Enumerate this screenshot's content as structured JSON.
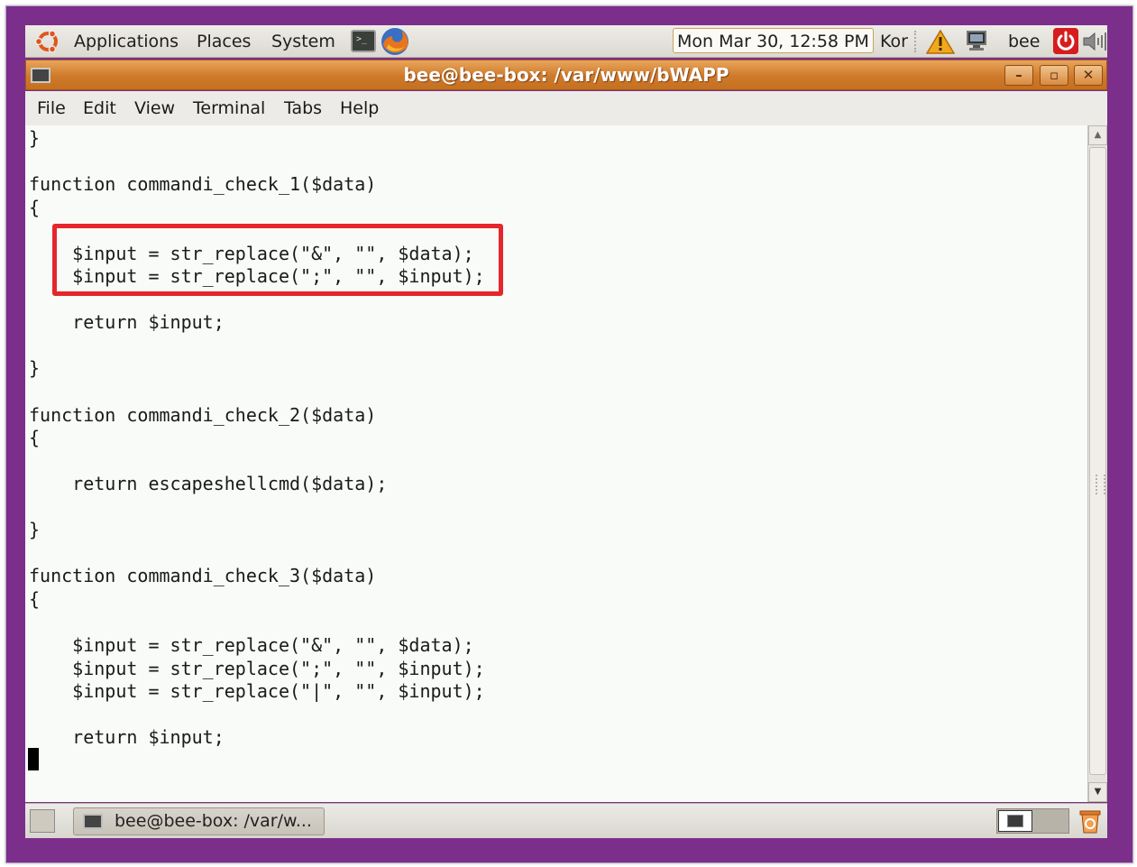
{
  "top_panel": {
    "menus": [
      "Applications",
      "Places",
      "System"
    ],
    "clock": "Mon Mar 30, 12:58 PM",
    "keyboard_layout": "Kor",
    "user": "bee",
    "icons": [
      "ubuntu-logo-icon",
      "terminal-launcher-icon",
      "firefox-icon",
      "warning-icon",
      "network-icon",
      "power-icon",
      "volume-icon"
    ]
  },
  "window": {
    "title": "bee@bee-box: /var/www/bWAPP",
    "buttons": {
      "minimize": "–",
      "maximize": "▫",
      "close": "✕"
    }
  },
  "menubar": [
    "File",
    "Edit",
    "View",
    "Terminal",
    "Tabs",
    "Help"
  ],
  "terminal": {
    "lines": [
      "}",
      "",
      "function commandi_check_1($data)",
      "{",
      "",
      "    $input = str_replace(\"&\", \"\", $data);",
      "    $input = str_replace(\";\", \"\", $input);",
      "",
      "    return $input;",
      "",
      "}",
      "",
      "function commandi_check_2($data)",
      "{",
      "",
      "    return escapeshellcmd($data);",
      "",
      "}",
      "",
      "function commandi_check_3($data)",
      "{",
      "",
      "    $input = str_replace(\"&\", \"\", $data);",
      "    $input = str_replace(\";\", \"\", $input);",
      "    $input = str_replace(\"|\", \"\", $input);",
      "",
      "    return $input;"
    ],
    "highlight_color": "#e5262b",
    "background": "#f8fbf7"
  },
  "bottom_panel": {
    "taskbar_label": "bee@bee-box: /var/w...",
    "icons": [
      "show-desktop-icon",
      "workspace-switcher",
      "trash-icon"
    ]
  },
  "colors": {
    "frame": "#7b2f8a",
    "titlebar": "#cf7a2b"
  }
}
